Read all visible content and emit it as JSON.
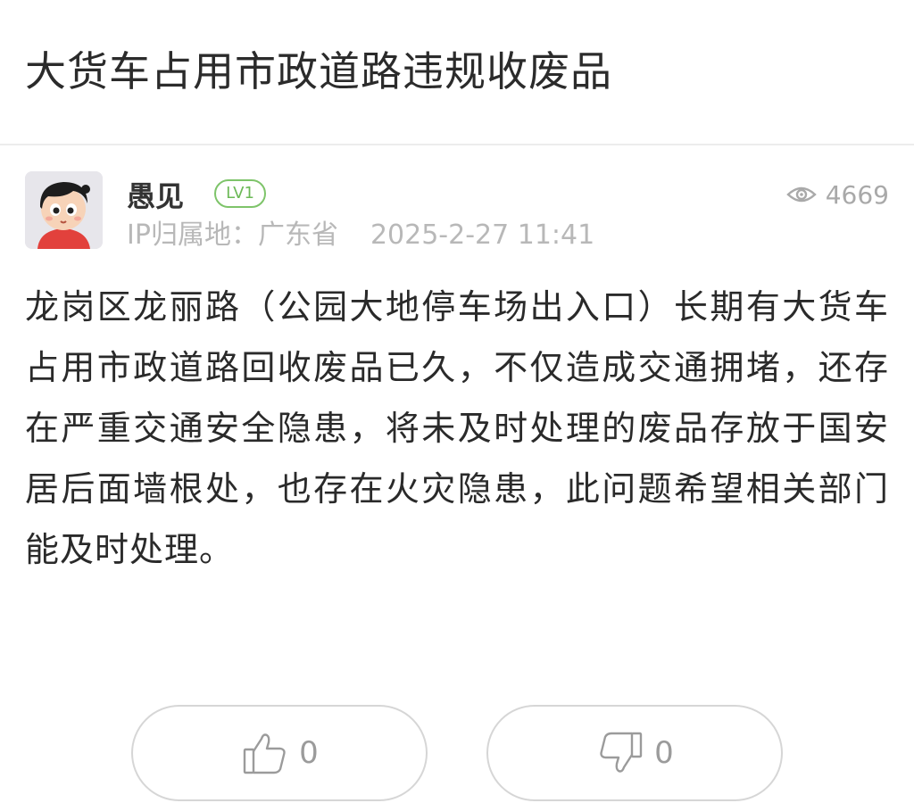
{
  "post": {
    "title": "大货车占用市政道路违规收废品",
    "author": {
      "name": "愚见",
      "level": "LV1",
      "avatar_icon": "cartoon-avatar"
    },
    "views": "4669",
    "ip_location": "IP归属地：广东省",
    "timestamp": "2025-2-27 11:41",
    "body": "龙岗区龙丽路（公园大地停车场出入口）长期有大货车占用市政道路回收废品已久，不仅造成交通拥堵，还存在严重交通安全隐患，将未及时处理的废品存放于国安居后面墙根处，也存在火灾隐患，此问题希望相关部门能及时处理。"
  },
  "actions": {
    "like_count": "0",
    "dislike_count": "0"
  },
  "colors": {
    "badge_green": "#6cb957",
    "meta_gray": "#b8b8b8",
    "border_gray": "#d6d6d6"
  }
}
